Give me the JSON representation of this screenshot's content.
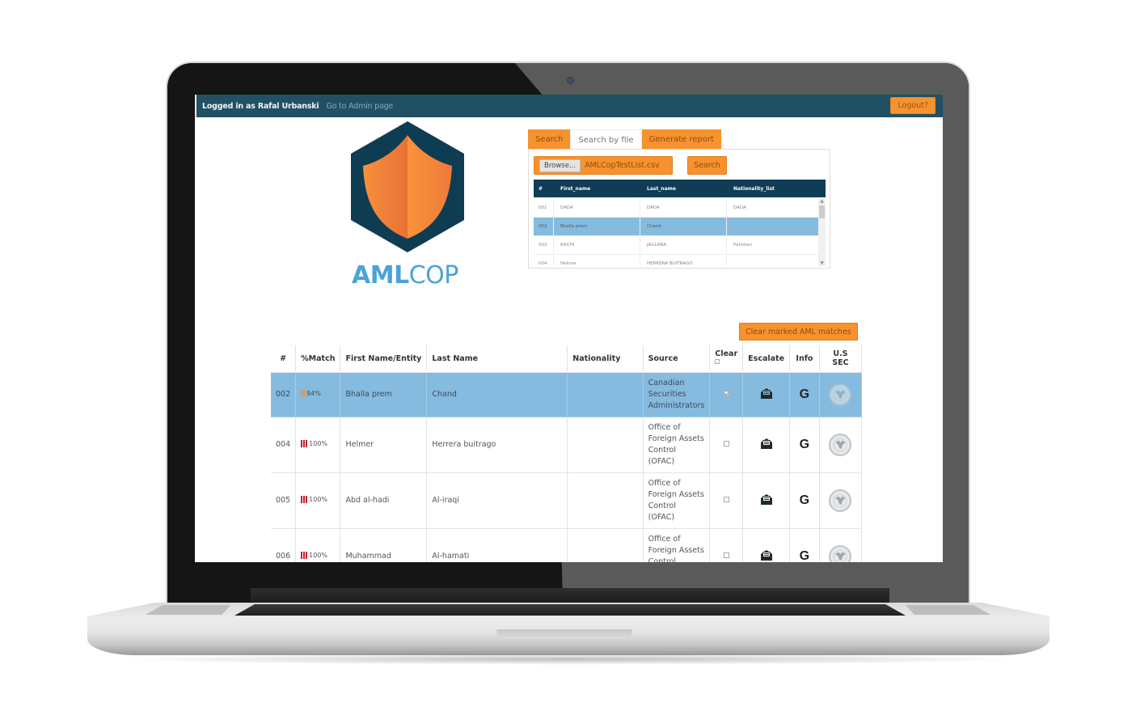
{
  "topbar": {
    "logged_in_text": "Logged in as Rafal Urbanski",
    "admin_link": "Go to Admin page",
    "logout_label": "Logout?"
  },
  "logo": {
    "text_bold": "AML",
    "text_light": "COP"
  },
  "search_panel": {
    "tabs": [
      {
        "label": "Search",
        "active": false
      },
      {
        "label": "Search by file",
        "active": true
      },
      {
        "label": "Generate report",
        "active": false
      }
    ],
    "browse_label": "Browse...",
    "file_name": "AMLCopTestList.csv",
    "search_label": "Search",
    "columns": [
      "#",
      "First_name",
      "Last_name",
      "Nationality_list"
    ],
    "rows": [
      {
        "num": "001",
        "first": "DADA",
        "last": "DADA",
        "nationality": "DADA",
        "selected": false
      },
      {
        "num": "002",
        "first": "Bhalla prem",
        "last": "Chand",
        "nationality": "",
        "selected": true
      },
      {
        "num": "003",
        "first": "KASTA",
        "last": "JAGLANA",
        "nationality": "Pakistan",
        "selected": false
      },
      {
        "num": "004",
        "first": "Helmer",
        "last": "HERRERA BUITRAGO",
        "nationality": "",
        "selected": false
      }
    ]
  },
  "clear_button_label": "Clear marked AML matches",
  "results": {
    "columns": [
      "#",
      "%Match",
      "First Name/Entity",
      "Last Name",
      "Nationality",
      "Source",
      "Clear",
      "Escalate",
      "Info",
      "U.S SEC"
    ],
    "rows": [
      {
        "num": "002",
        "match": "94%",
        "first": "Bhalla prem",
        "last": "Chand",
        "nationality": "",
        "source": "Canadian Securities Administrators",
        "cleared": true,
        "selected": true
      },
      {
        "num": "004",
        "match": "100%",
        "first": "Helmer",
        "last": "Herrera buitrago",
        "nationality": "",
        "source": "Office of Foreign Assets Control (OFAC)",
        "cleared": false,
        "selected": false
      },
      {
        "num": "005",
        "match": "100%",
        "first": "Abd al-hadi",
        "last": "Al-iraqi",
        "nationality": "",
        "source": "Office of Foreign Assets Control (OFAC)",
        "cleared": false,
        "selected": false
      },
      {
        "num": "006",
        "match": "100%",
        "first": "Muhammad",
        "last": "Al-hamati",
        "nationality": "",
        "source": "Office of Foreign Assets Control (OFAC)",
        "cleared": false,
        "selected": false
      }
    ],
    "icons": {
      "escalate": "envelope-open-icon",
      "info": "google-icon",
      "sec": "sec-seal-icon"
    }
  },
  "colors": {
    "topbar": "#215064",
    "accent_orange": "#f7922e",
    "table_header_dark": "#0f3d55",
    "selected_row": "#86bbe0",
    "logo_blue": "#4aa3d9",
    "match_high": "#c0242e",
    "match_medium": "#f7922e"
  }
}
